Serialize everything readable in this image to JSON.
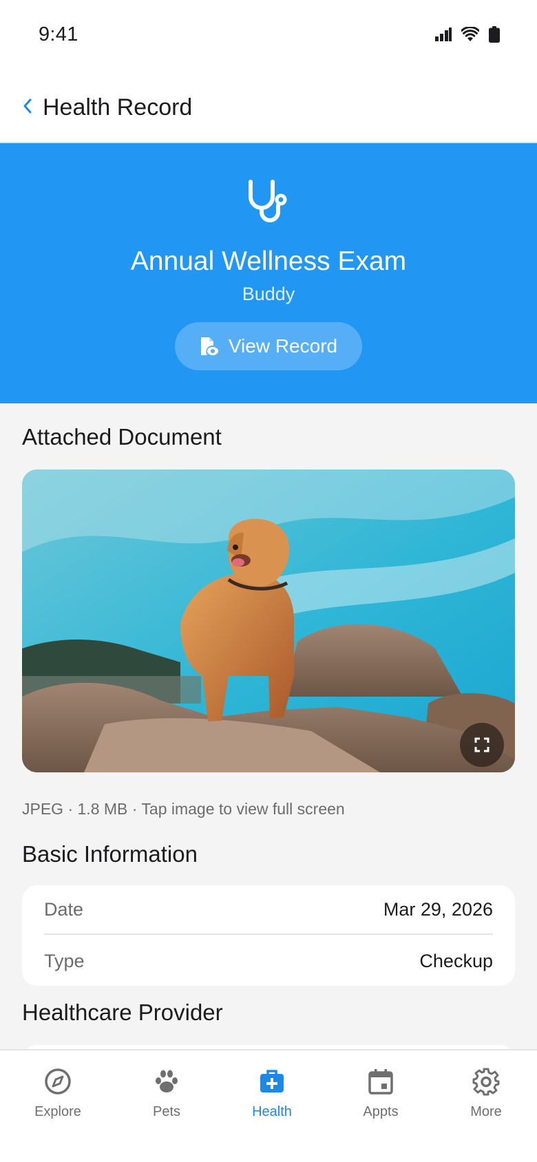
{
  "status_bar": {
    "time": "9:41"
  },
  "app_bar": {
    "title": "Health Record"
  },
  "hero": {
    "title": "Annual Wellness Exam",
    "pet_name": "Buddy",
    "view_record_label": "View Record"
  },
  "attached_document": {
    "section_title": "Attached Document",
    "meta": "JPEG · 1.8 MB · Tap image to view full screen"
  },
  "basic_information": {
    "section_title": "Basic Information",
    "rows": [
      {
        "label": "Date",
        "value": "Mar 29, 2026"
      },
      {
        "label": "Type",
        "value": "Checkup"
      }
    ]
  },
  "healthcare_provider": {
    "section_title": "Healthcare Provider"
  },
  "bottom_nav": {
    "items": [
      {
        "label": "Explore",
        "icon": "compass-icon"
      },
      {
        "label": "Pets",
        "icon": "paw-icon"
      },
      {
        "label": "Health",
        "icon": "medical-bag-icon",
        "active": true
      },
      {
        "label": "Appts",
        "icon": "calendar-icon"
      },
      {
        "label": "More",
        "icon": "gear-icon"
      }
    ]
  },
  "colors": {
    "accent": "#2196f3",
    "active_nav": "#1e88e5",
    "background": "#f4f4f4",
    "card": "#ffffff"
  }
}
